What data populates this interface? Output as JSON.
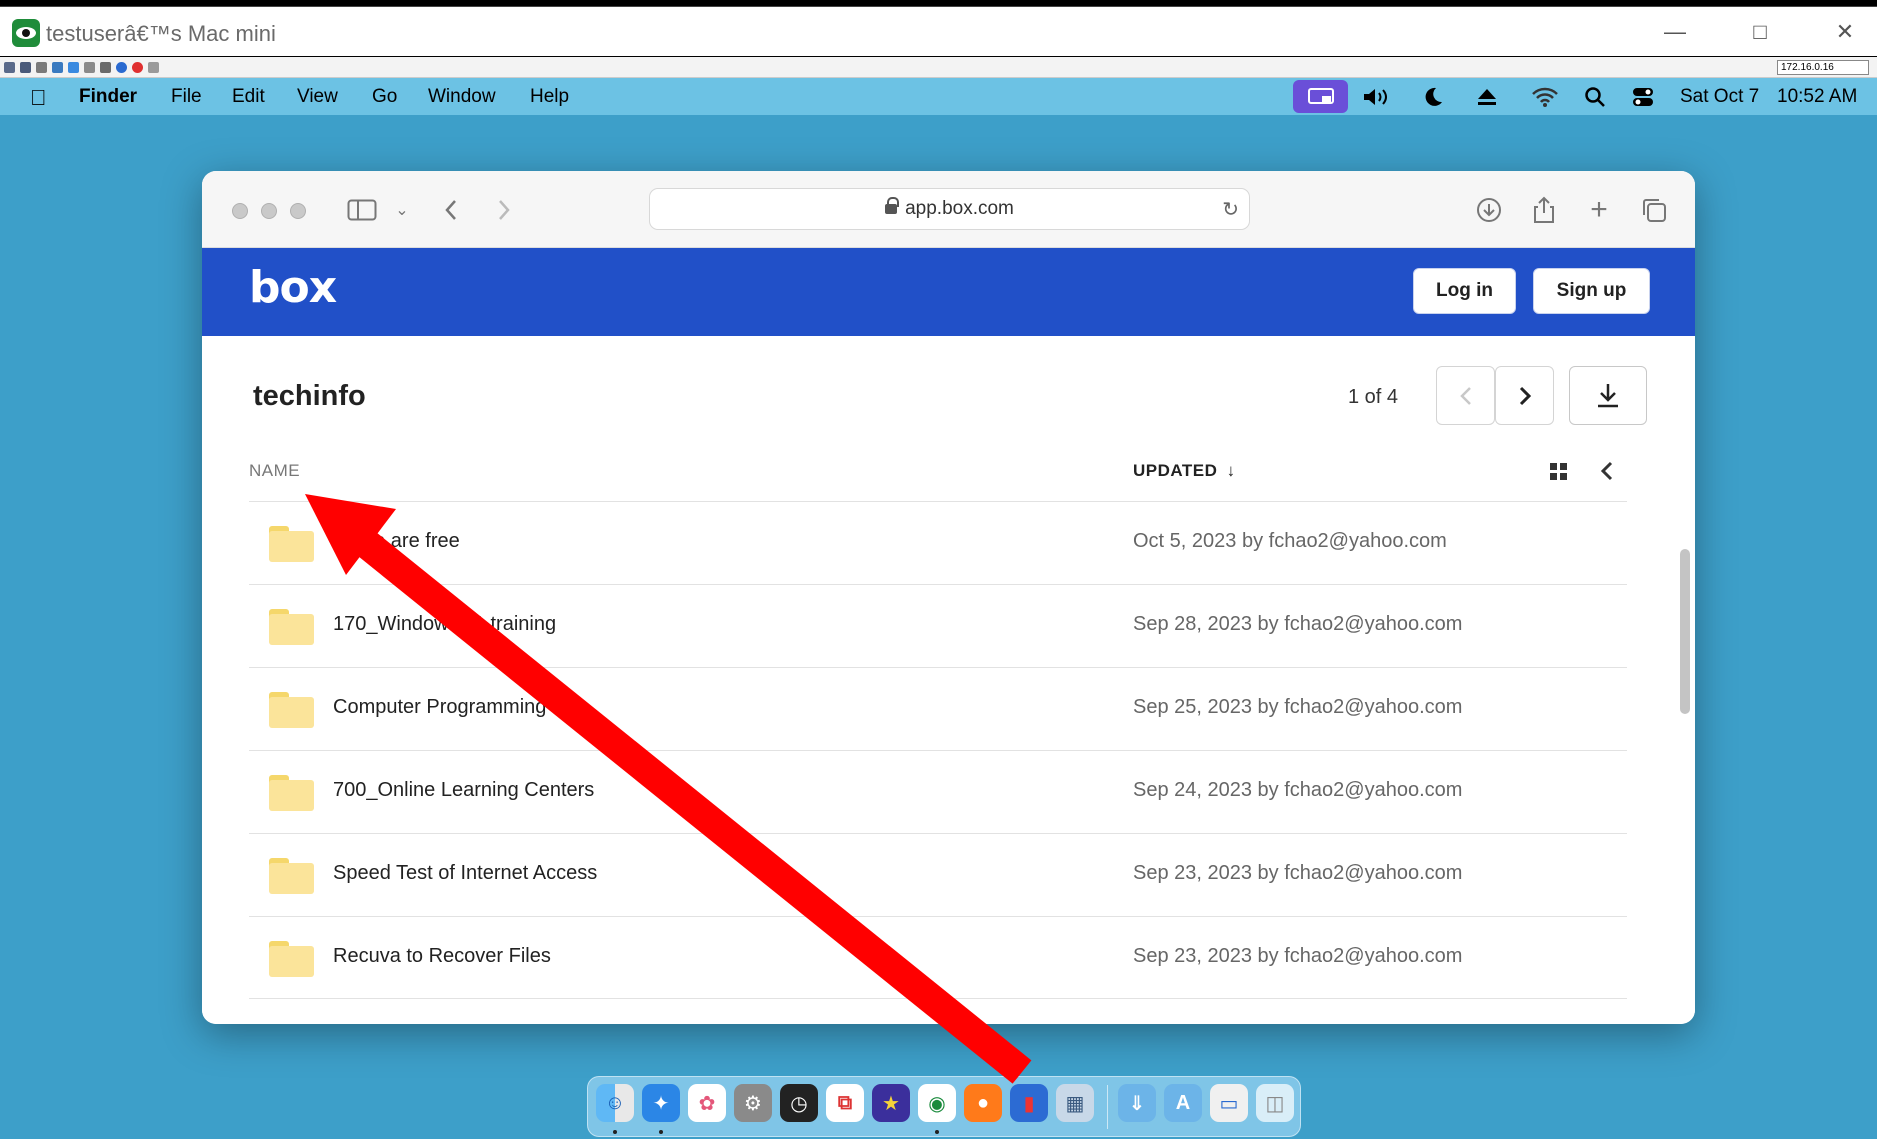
{
  "vnc": {
    "title": "testuserâ€™s Mac mini",
    "ip": "172.16.0.16"
  },
  "menubar": {
    "apple_icon": "apple-logo-icon",
    "items": [
      "Finder",
      "File",
      "Edit",
      "View",
      "Go",
      "Window",
      "Help"
    ],
    "date": "Sat Oct 7",
    "time": "10:52 AM"
  },
  "browser": {
    "url": "app.box.com"
  },
  "box": {
    "logo": "box",
    "login_label": "Log in",
    "signup_label": "Sign up",
    "folder_title": "techinfo",
    "pager": "1 of 4",
    "col_name": "NAME",
    "col_updated": "UPDATED",
    "rows": [
      {
        "name": "Some are free",
        "updated": "Oct 5, 2023 by fchao2@yahoo.com"
      },
      {
        "name": "170_Windows 11 training",
        "updated": "Sep 28, 2023 by fchao2@yahoo.com"
      },
      {
        "name": "Computer Programming",
        "updated": "Sep 25, 2023 by fchao2@yahoo.com"
      },
      {
        "name": "700_Online Learning Centers",
        "updated": "Sep 24, 2023 by fchao2@yahoo.com"
      },
      {
        "name": "Speed Test of Internet Access",
        "updated": "Sep 23, 2023 by fchao2@yahoo.com"
      },
      {
        "name": "Recuva to Recover Files",
        "updated": "Sep 23, 2023 by fchao2@yahoo.com"
      }
    ]
  },
  "colors": {
    "desktop": "#3d9fc9",
    "menubar": "#6cc2e4",
    "box_blue": "#2150c8",
    "arrow": "#ff0000"
  }
}
